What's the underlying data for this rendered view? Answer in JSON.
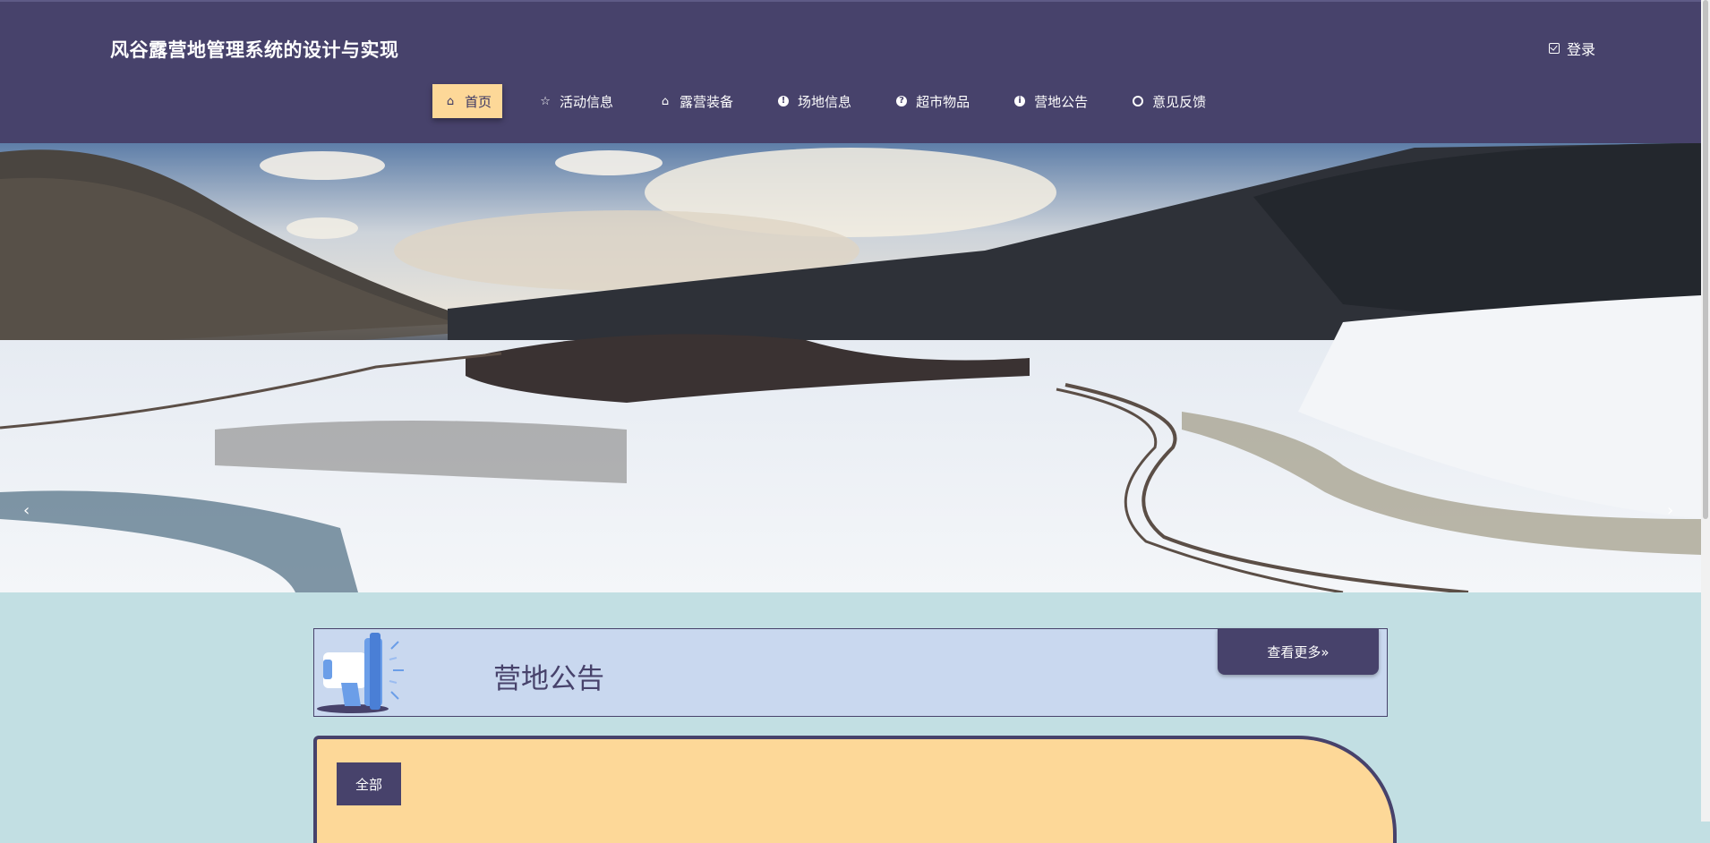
{
  "header": {
    "site_title": "风谷露营地管理系统的设计与实现",
    "login_label": "登录"
  },
  "nav": [
    {
      "label": "首页",
      "icon": "home-icon",
      "active": true
    },
    {
      "label": "活动信息",
      "icon": "star-icon"
    },
    {
      "label": "露营装备",
      "icon": "bag-icon"
    },
    {
      "label": "场地信息",
      "icon": "info-icon"
    },
    {
      "label": "超市物品",
      "icon": "question-icon"
    },
    {
      "label": "营地公告",
      "icon": "info-icon"
    },
    {
      "label": "意见反馈",
      "icon": "feedback-icon"
    }
  ],
  "banner": {
    "prev_label": "‹",
    "next_label": "›"
  },
  "notice": {
    "title": "营地公告",
    "more_label": "查看更多»"
  },
  "content": {
    "tab_all_label": "全部"
  },
  "colors": {
    "header_bg": "#47426b",
    "page_bg": "#c2dfe3",
    "accent": "#fdd898",
    "notice_bg": "#c9d8ef"
  }
}
